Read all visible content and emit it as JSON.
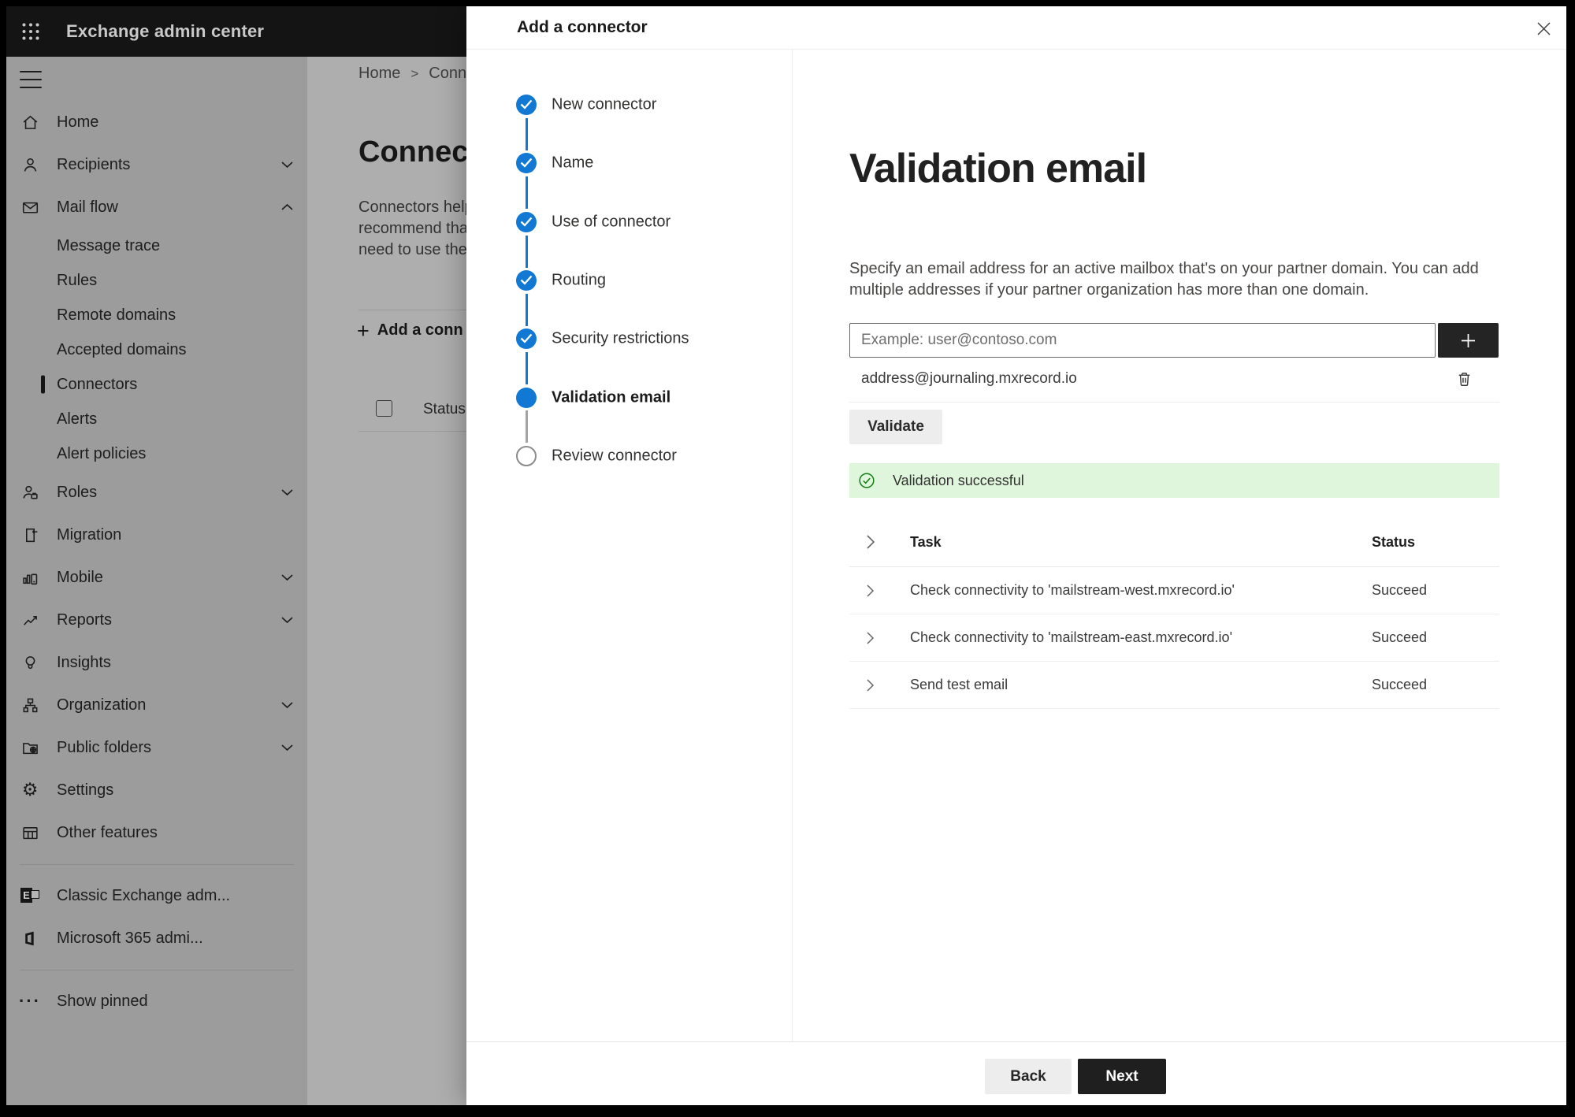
{
  "topbar": {
    "title": "Exchange admin center",
    "app_launcher_icon": "app-grid-icon"
  },
  "sidebar": {
    "items": [
      {
        "label": "Home",
        "icon": "home-icon"
      },
      {
        "label": "Recipients",
        "icon": "person-icon",
        "chevron": "down"
      },
      {
        "label": "Mail flow",
        "icon": "mail-icon",
        "chevron": "up"
      },
      {
        "label": "Message trace"
      },
      {
        "label": "Rules"
      },
      {
        "label": "Remote domains"
      },
      {
        "label": "Accepted domains"
      },
      {
        "label": "Connectors",
        "selected": true
      },
      {
        "label": "Alerts"
      },
      {
        "label": "Alert policies"
      },
      {
        "label": "Roles",
        "icon": "person-badge-icon",
        "chevron": "down"
      },
      {
        "label": "Migration",
        "icon": "document-arrow-icon"
      },
      {
        "label": "Mobile",
        "icon": "chart-phone-icon",
        "chevron": "down"
      },
      {
        "label": "Reports",
        "icon": "line-chart-icon",
        "chevron": "down"
      },
      {
        "label": "Insights",
        "icon": "lightbulb-icon"
      },
      {
        "label": "Organization",
        "icon": "org-chart-icon",
        "chevron": "down"
      },
      {
        "label": "Public folders",
        "icon": "folder-globe-icon",
        "chevron": "down"
      },
      {
        "label": "Settings",
        "icon": "gear-icon",
        "gear_glyph": "⚙"
      },
      {
        "label": "Other features",
        "icon": "table-icon"
      },
      {
        "label": "Classic Exchange adm...",
        "icon": "exchange-logo-icon",
        "logo_letter": "E"
      },
      {
        "label": "Microsoft 365 admi...",
        "icon": "office-logo-icon"
      },
      {
        "label": "Show pinned",
        "icon": "ellipsis-icon",
        "ellipsis_glyph": "···"
      }
    ]
  },
  "background_page": {
    "breadcrumb": {
      "home": "Home",
      "separator": ">",
      "current": "Conne"
    },
    "heading": "Connec",
    "description_lines": [
      "Connectors help",
      "recommend tha",
      "need to use ther"
    ],
    "add_button_plus": "+",
    "add_button_label": "Add a conn",
    "list_status_header": "Status"
  },
  "modal": {
    "title": "Add a connector",
    "close_icon": "close-icon",
    "steps": [
      {
        "label": "New connector",
        "state": "done"
      },
      {
        "label": "Name",
        "state": "done"
      },
      {
        "label": "Use of connector",
        "state": "done"
      },
      {
        "label": "Routing",
        "state": "done"
      },
      {
        "label": "Security restrictions",
        "state": "done"
      },
      {
        "label": "Validation email",
        "state": "current"
      },
      {
        "label": "Review connector",
        "state": "upcoming"
      }
    ],
    "content": {
      "title": "Validation email",
      "description_line1": "Specify an email address for an active mailbox that's on your partner domain. You can add",
      "description_line2": "multiple addresses if your partner organization has more than one domain.",
      "input_placeholder": "Example: user@contoso.com",
      "add_address_icon": "plus-icon",
      "added_address": "address@journaling.mxrecord.io",
      "delete_icon": "trash-icon",
      "validate_button": "Validate",
      "success_icon": "check-circle-icon",
      "success_message": "Validation successful",
      "success_bg": "#dff6dd",
      "success_icon_color": "#107c10",
      "accent_blue": "#1179d4",
      "table": {
        "task_header": "Task",
        "status_header": "Status",
        "rows": [
          {
            "task": "Check connectivity to 'mailstream-west.mxrecord.io'",
            "status": "Succeed"
          },
          {
            "task": "Check connectivity to 'mailstream-east.mxrecord.io'",
            "status": "Succeed"
          },
          {
            "task": "Send test email",
            "status": "Succeed"
          }
        ]
      },
      "back_button": "Back",
      "next_button": "Next"
    }
  }
}
